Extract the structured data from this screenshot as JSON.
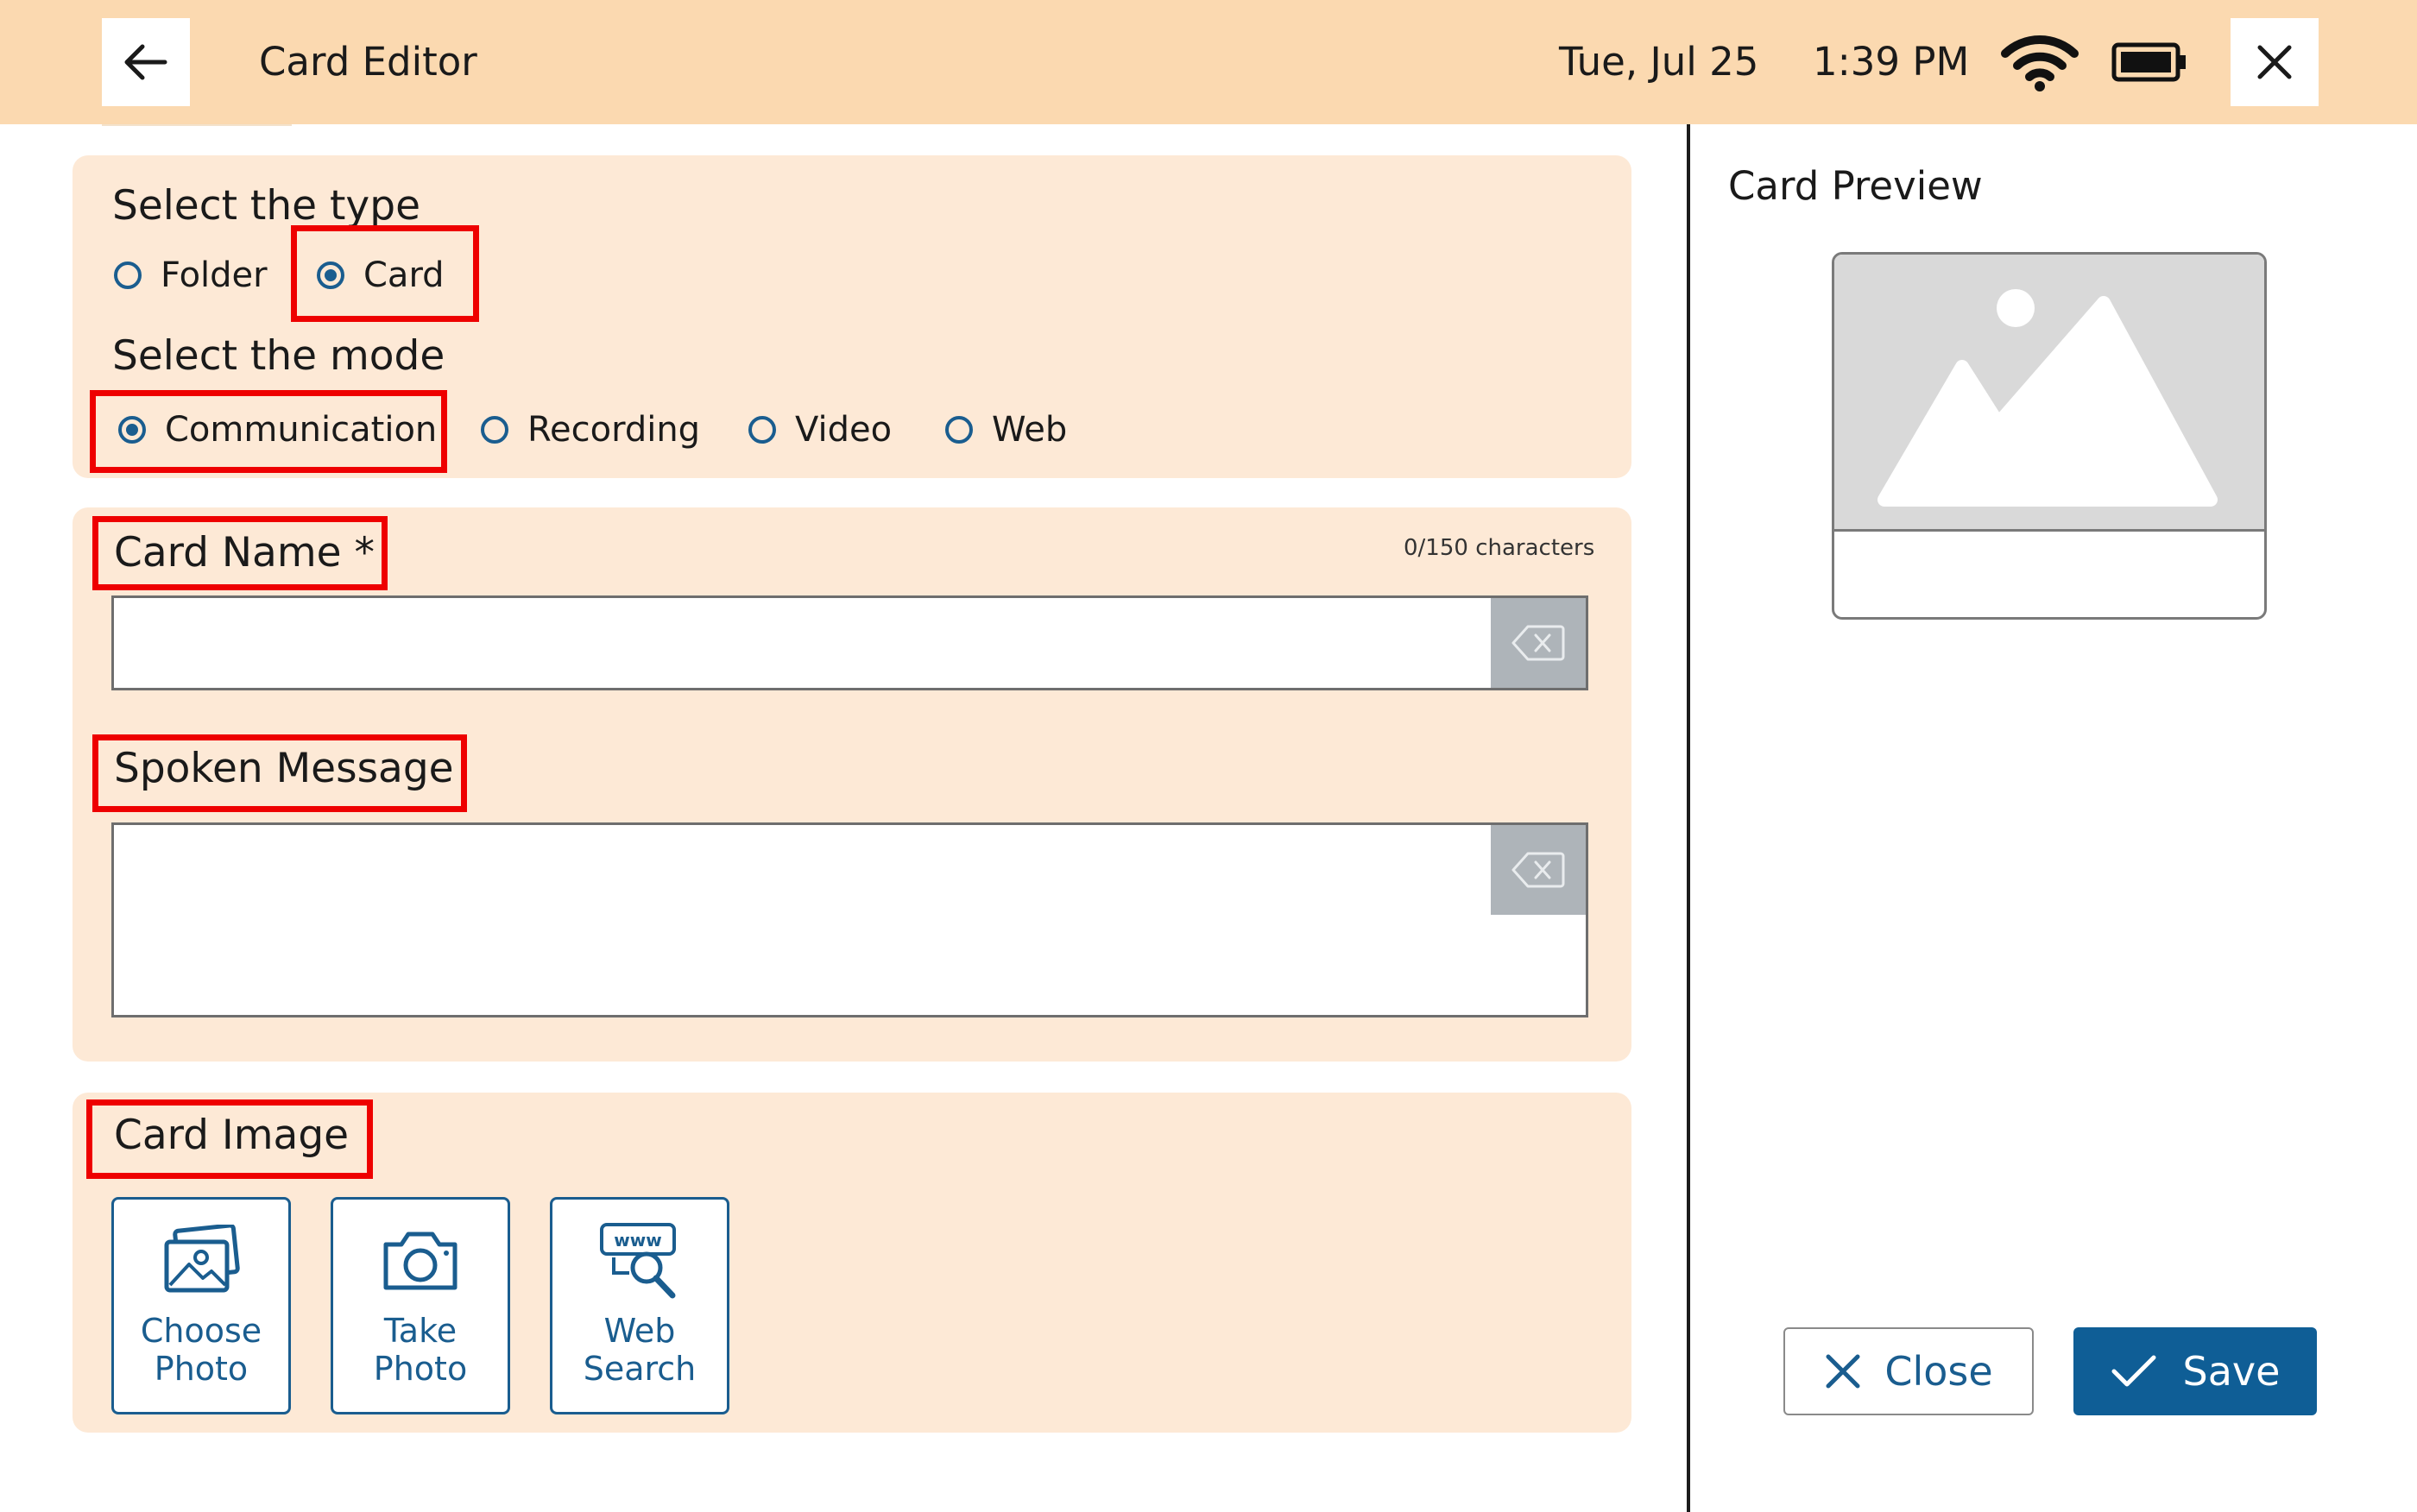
{
  "header": {
    "title": "Card Editor",
    "date": "Tue, Jul 25",
    "time": "1:39 PM",
    "back_icon": "arrow-left-icon",
    "close_icon": "close-icon",
    "wifi_icon": "wifi-icon",
    "battery_icon": "battery-icon"
  },
  "type_section": {
    "heading": "Select the type",
    "options": [
      {
        "label": "Folder",
        "checked": false
      },
      {
        "label": "Card",
        "checked": true
      }
    ]
  },
  "mode_section": {
    "heading": "Select the mode",
    "options": [
      {
        "label": "Communication",
        "checked": true
      },
      {
        "label": "Recording",
        "checked": false
      },
      {
        "label": "Video",
        "checked": false
      },
      {
        "label": "Web",
        "checked": false
      }
    ]
  },
  "card_name": {
    "label": "Card Name *",
    "value": "",
    "counter": "0/150 characters"
  },
  "spoken_message": {
    "label": "Spoken Message",
    "value": ""
  },
  "card_image": {
    "label": "Card Image",
    "buttons": [
      {
        "label": "Choose\nPhoto",
        "icon": "photos-icon"
      },
      {
        "label": "Take\nPhoto",
        "icon": "camera-icon"
      },
      {
        "label": "Web\nSearch",
        "icon": "web-search-icon"
      }
    ]
  },
  "preview": {
    "title": "Card Preview",
    "image_icon": "image-placeholder-icon"
  },
  "actions": {
    "close_label": "Close",
    "save_label": "Save"
  },
  "colors": {
    "header_bg": "#fbd9b0",
    "panel_bg": "#fde9d6",
    "accent": "#0f5e96",
    "highlight": "#ee0000"
  }
}
